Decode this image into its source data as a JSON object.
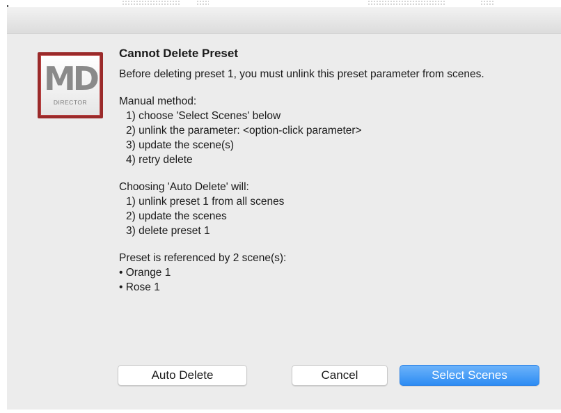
{
  "dialog": {
    "title": "Cannot Delete Preset",
    "intro": "Before deleting preset 1, you must unlink this preset parameter from scenes.",
    "manual": {
      "heading": "Manual method:",
      "steps": [
        "1) choose 'Select Scenes' below",
        "2) unlink the parameter: <option-click parameter>",
        "3) update the scene(s)",
        "4) retry delete"
      ]
    },
    "auto": {
      "heading": "Choosing 'Auto Delete' will:",
      "steps": [
        "1) unlink preset 1 from all scenes",
        "2) update the scenes",
        "3) delete preset 1"
      ]
    },
    "references": {
      "heading": "Preset is referenced by 2 scene(s):",
      "scenes": [
        "• Orange 1",
        "• Rose 1"
      ]
    }
  },
  "logo": {
    "mark": "MD",
    "subtitle": "DIRECTOR"
  },
  "buttons": {
    "auto_delete": "Auto Delete",
    "cancel": "Cancel",
    "select_scenes": "Select Scenes"
  },
  "colors": {
    "dialog_bg": "#ececec",
    "logo_frame": "#9a2a2a",
    "default_button": "#2d8cf3"
  }
}
